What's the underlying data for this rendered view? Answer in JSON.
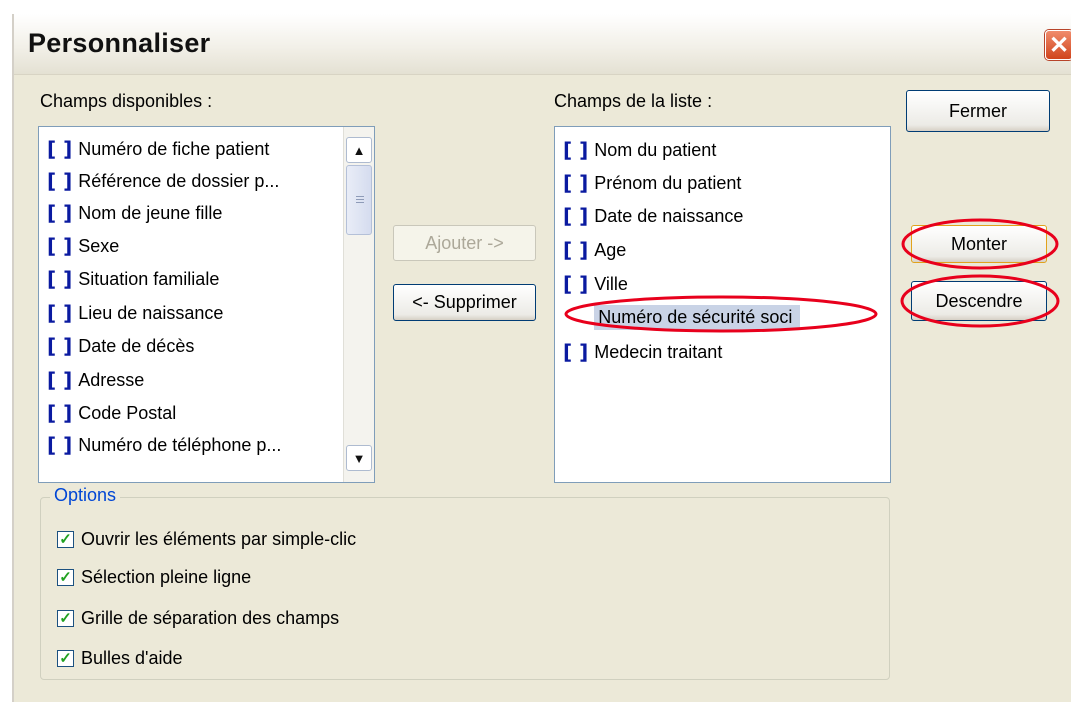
{
  "dialog": {
    "title": "Personnaliser"
  },
  "available": {
    "label": "Champs disponibles :",
    "bracket": "[ ]",
    "items": [
      "Numéro de fiche patient",
      "Référence de dossier p...",
      "Nom de jeune fille",
      "Sexe",
      "Situation familiale",
      "Lieu de naissance",
      "Date de décès",
      "Adresse",
      "Code Postal",
      "Numéro de téléphone p..."
    ]
  },
  "list": {
    "label": "Champs de la liste :",
    "bracket": "[ ]",
    "items": [
      "Nom du patient",
      "Prénom du patient",
      "Date de naissance",
      "Age",
      "Ville",
      "Numéro de sécurité soci",
      "Medecin traitant"
    ],
    "selected_index": 5
  },
  "buttons": {
    "add": "Ajouter ->",
    "remove": "<- Supprimer",
    "close": "Fermer",
    "up": "Monter",
    "down": "Descendre"
  },
  "options": {
    "title": "Options",
    "items": [
      {
        "label": "Ouvrir les éléments par simple-clic",
        "checked": true
      },
      {
        "label": "Sélection pleine ligne",
        "checked": true
      },
      {
        "label": "Grille de séparation des champs",
        "checked": true
      },
      {
        "label": "Bulles d'aide",
        "checked": true
      }
    ]
  },
  "icons": {
    "close": "close-icon",
    "scroll_up": "chevron-up-icon",
    "scroll_down": "chevron-down-icon"
  },
  "colors": {
    "annotation": "#e8001c",
    "bracket": "#0a1aa0",
    "selection": "#c9d3e6",
    "check": "#21a121"
  }
}
